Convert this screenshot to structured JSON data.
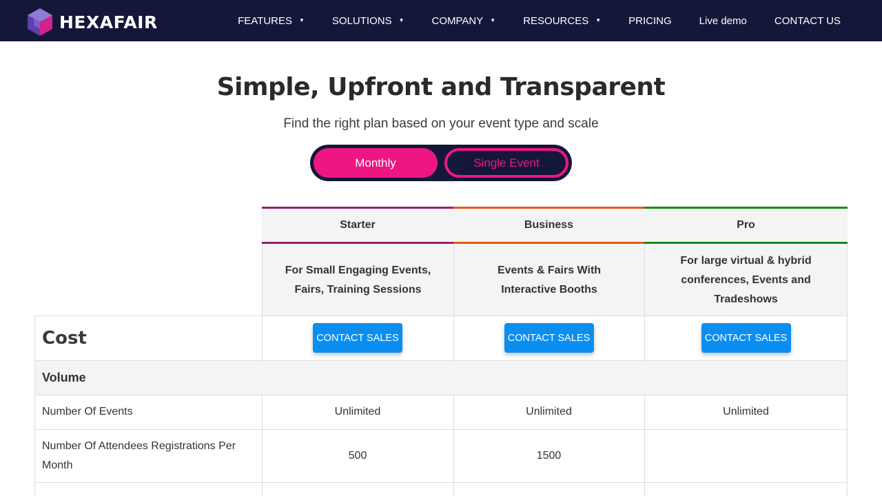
{
  "brand": {
    "name": "HEXAFAIR"
  },
  "nav": {
    "features": "FEATURES",
    "solutions": "SOLUTIONS",
    "company": "COMPANY",
    "resources": "RESOURCES",
    "pricing": "PRICING",
    "live_demo": "Live demo",
    "contact": "CONTACT US"
  },
  "hero": {
    "title": "Simple, Upfront and Transparent",
    "subtitle": "Find the right plan based on your event type and scale"
  },
  "toggle": {
    "monthly": "Monthly",
    "single_event": "Single Event"
  },
  "plans": [
    {
      "name": "Starter",
      "description": "For Small Engaging Events, Fairs, Training Sessions",
      "color": "#9c1c70"
    },
    {
      "name": "Business",
      "description": "Events & Fairs With Interactive Booths",
      "color": "#e55a16"
    },
    {
      "name": "Pro",
      "description": "For large virtual & hybrid conferences, Events and Tradeshows",
      "color": "#168a1a"
    }
  ],
  "table": {
    "cost_label": "Cost",
    "contact_sales": "CONTACT SALES",
    "volume_label": "Volume",
    "rows": [
      {
        "label": "Number Of Events",
        "values": [
          "Unlimited",
          "Unlimited",
          "Unlimited"
        ]
      },
      {
        "label": "Number Of Attendees Registrations Per Month",
        "values": [
          "500",
          "1500",
          ""
        ]
      }
    ]
  },
  "colors": {
    "header_bg": "#141739",
    "accent_pink": "#ee1681",
    "cta_blue": "#0a8ef2"
  }
}
